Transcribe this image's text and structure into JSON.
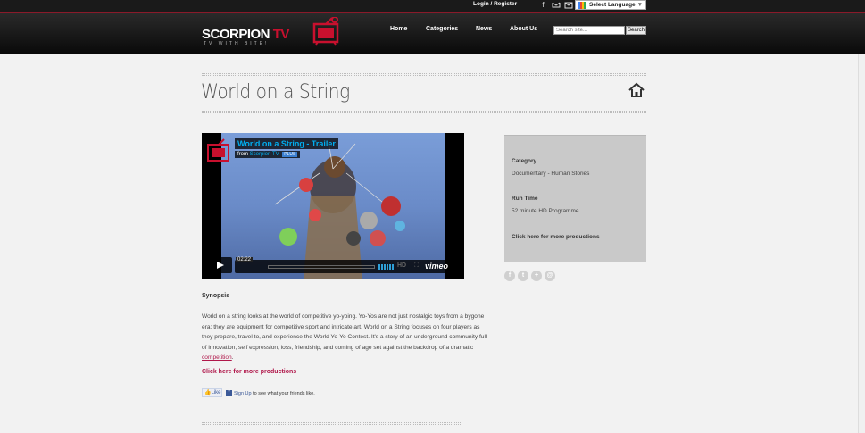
{
  "topbar": {
    "login_label": "Login / Register",
    "social_icons": [
      "facebook-icon",
      "twitter-icon",
      "email-icon"
    ],
    "language_label": "Select Language",
    "language_arrow": "▼"
  },
  "header": {
    "logo_word_main": "SCORPION",
    "logo_word_accent": "TV",
    "logo_tagline": "TV WITH BITE!",
    "nav": [
      "Home",
      "Categories",
      "News",
      "About Us"
    ],
    "search_placeholder": "Search site...",
    "search_button": "Search"
  },
  "page": {
    "title": "World on a String"
  },
  "video": {
    "title": "World on a String - Trailer",
    "from_label": "from",
    "from_user": "Scorpion TV",
    "plus_badge": "PLUS",
    "time": "02:22",
    "hd_label": "HD",
    "brand": "vimeo"
  },
  "synopsis": {
    "heading": "Synopsis",
    "body": "World on a string looks at the world of competitive yo-yoing. Yo-Yos are not just nostalgic toys from a bygone era; they are equipment for competitive sport and intricate art. World on a String focuses on four players as they prepare, travel to, and experience the World Yo-Yo Contest. It's a story of an underground community full of innovation, self expression, loss, friendship, and coming of age set against the backdrop of a dramatic ",
    "body_link": "competition",
    "body_end": "."
  },
  "more_link": "Click here for more productions",
  "facebook": {
    "like_label": "Like",
    "signup_link": "Sign Up",
    "signup_text": " to see what your friends like."
  },
  "sidebar": {
    "category_label": "Category",
    "category_value": "Documentary - Human Stories",
    "runtime_label": "Run Time",
    "runtime_value": "52 minute HD Programme",
    "more_link": "Click here for more productions"
  },
  "share_icons": [
    "facebook-icon",
    "twitter-icon",
    "google-plus-icon",
    "email-icon"
  ],
  "colors": {
    "accent": "#b0174a",
    "logo_red": "#c8102e",
    "vimeo_blue": "#00adef",
    "sidebar_bg": "#c9c9c9"
  }
}
